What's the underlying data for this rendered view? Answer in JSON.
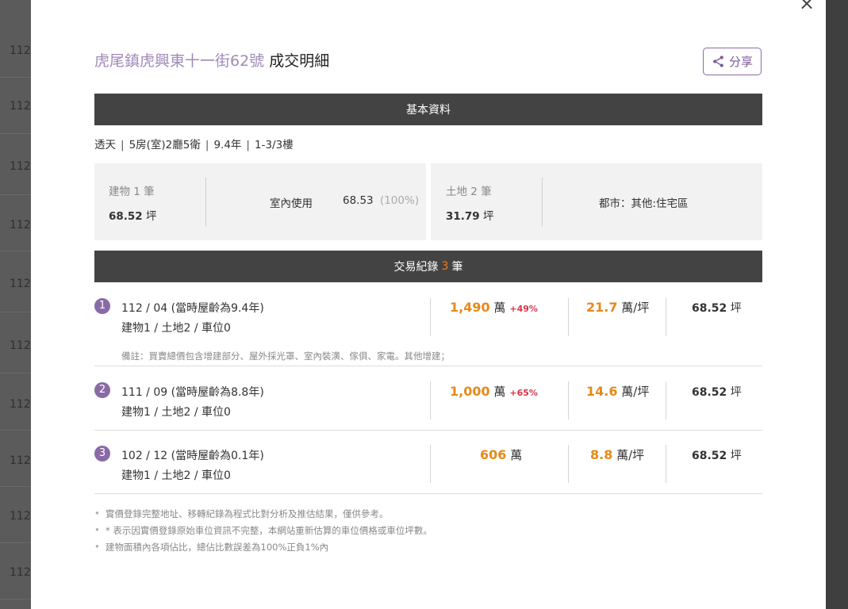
{
  "background": {
    "row_text": "112"
  },
  "modal": {
    "close_icon": "×",
    "title_address": "虎尾鎮虎興東十一街62號",
    "title_suffix": " 成交明細",
    "share_label": "分享"
  },
  "basic": {
    "header": "基本資料",
    "building_type": "透天",
    "layout": "5房(室)2廳5衛",
    "age": "9.4年",
    "floor": "1-3/3樓",
    "separator": "|"
  },
  "building_card": {
    "label": "建物 1 筆",
    "area_value": "68.52",
    "area_unit": "坪",
    "indoor_label": "室內使用",
    "indoor_value": "68.53",
    "indoor_pct": "(100%)"
  },
  "land_card": {
    "label": "土地 2 筆",
    "area_value": "31.79",
    "area_unit": "坪",
    "zoning": "都市：其他:住宅區"
  },
  "transactions": {
    "header_prefix": "交易紀錄",
    "count": "3",
    "header_suffix": "筆",
    "items": [
      {
        "index": "1",
        "date": "112 / 04 (當時屋齡為9.4年)",
        "parcels": "建物1 / 土地2 / 車位0",
        "price": "1,490",
        "price_unit": "萬",
        "pct": "+49%",
        "unit_price": "21.7",
        "unit_price_unit": "萬/坪",
        "area": "68.52",
        "area_unit": "坪",
        "note": "備註：買賣總價包含增建部分、屋外採光罩、室內裝潢、傢俱、家電。其他增建；"
      },
      {
        "index": "2",
        "date": "111 / 09 (當時屋齡為8.8年)",
        "parcels": "建物1 / 土地2 / 車位0",
        "price": "1,000",
        "price_unit": "萬",
        "pct": "+65%",
        "unit_price": "14.6",
        "unit_price_unit": "萬/坪",
        "area": "68.52",
        "area_unit": "坪"
      },
      {
        "index": "3",
        "date": "102 / 12 (當時屋齡為0.1年)",
        "parcels": "建物1 / 土地2 / 車位0",
        "price": "606",
        "price_unit": "萬",
        "unit_price": "8.8",
        "unit_price_unit": "萬/坪",
        "area": "68.52",
        "area_unit": "坪"
      }
    ]
  },
  "footnotes": [
    "實價登錄完整地址、移轉紀錄為程式比對分析及推估結果，僅供參考。",
    "* 表示因實價登錄原始車位資訊不完整，本網站重新估算的車位價格或車位坪數。",
    "建物面積內各項佔比，總佔比數誤差為100%正負1%內"
  ],
  "colors": {
    "accent_purple": "#8a6aa6",
    "price_orange": "#e68a19",
    "pct_red": "#d8364e",
    "bar_dark": "#434343"
  }
}
